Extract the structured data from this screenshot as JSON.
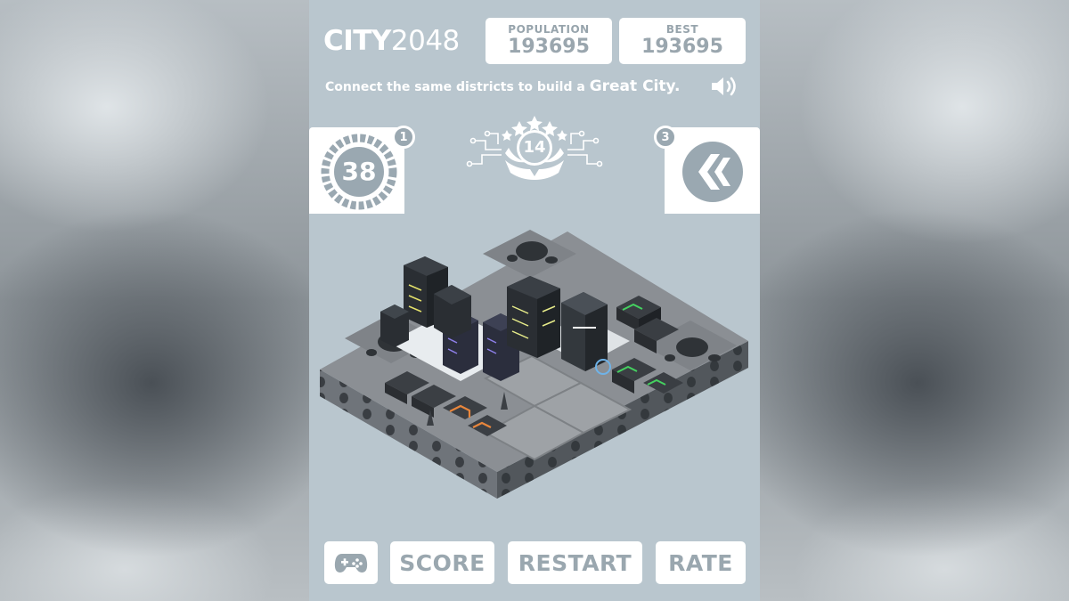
{
  "app": {
    "logo_bold": "CITY",
    "logo_light": "2048"
  },
  "scores": {
    "population_label": "POPULATION",
    "population_value": "193695",
    "best_label": "BEST",
    "best_value": "193695"
  },
  "tagline": {
    "text": "Connect the same districts to build a ",
    "emphasis": "Great City."
  },
  "powerups": {
    "left_value": "38",
    "left_count": "1",
    "right_count": "3",
    "level": "14"
  },
  "buttons": {
    "gamepad_icon": "gamepad-icon",
    "score": "SCORE",
    "restart": "RESTART",
    "rate": "RATE"
  },
  "colors": {
    "panel_bg": "#b9c6ce",
    "button_text": "#9aa7af",
    "tile_top": "#8b8f94",
    "tile_side": "#5e6369"
  }
}
